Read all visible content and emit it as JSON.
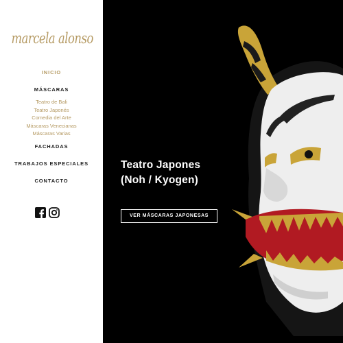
{
  "brand": {
    "logo_text": "marcela alonso"
  },
  "nav": {
    "inicio": "INICIO",
    "mascaras": "MÁSCARAS",
    "sub_items": [
      "Teatro de Bali",
      "Teatro Japonés",
      "Comedia del Arte",
      "Máscaras Venecianas",
      "Máscaras Varias"
    ],
    "fachadas": "FACHADAS",
    "trabajos": "TRABAJOS ESPECIALES",
    "contacto": "CONTACTO"
  },
  "social": {
    "icons": [
      "facebook-icon",
      "instagram-icon"
    ]
  },
  "hero": {
    "title_line1": "Teatro Japones",
    "title_line2": "(Noh / Kyogen)",
    "button_label": "VER MÁSCARAS JAPONESAS",
    "image": "hannya-mask-image"
  },
  "colors": {
    "accent": "#b59a63",
    "text": "#222222",
    "hero_bg": "#000000"
  }
}
